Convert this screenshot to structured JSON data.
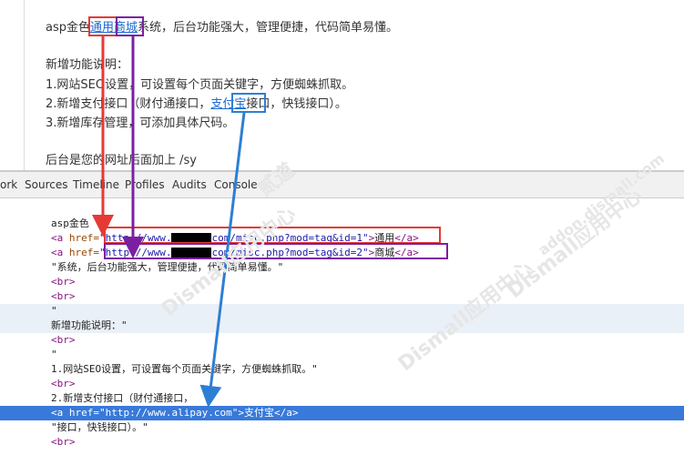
{
  "article": {
    "line1_pre": "asp金色",
    "line1_link1": "通用",
    "line1_link2": "商城",
    "line1_post": "系统，后台功能强大，管理便捷，代码简单易懂。",
    "features_title": "新增功能说明：",
    "feature1": "1.网站SEO设置，可设置每个页面关键字，方便蜘蛛抓取。",
    "feature2_pre": "2.新增支付接口（财付通接口，",
    "feature2_link": "支付宝",
    "feature2_post": "接口，快钱接口）。",
    "feature3": "3.新增库存管理，可添加具体尺码。",
    "footer": "后台是您的网址后面加上 /sy"
  },
  "devtools_tabs": [
    "ork",
    "Sources",
    "Timeline",
    "Profiles",
    "Audits",
    "Console"
  ],
  "dom": {
    "text_asp": "asp金色",
    "a1_open": "<a ",
    "a1_href_attr": "href=",
    "a1_href_pre": "\"http://www.",
    "a1_href_post": "com/misc.php?mod=tag&id=1\"",
    "a1_text": "通用",
    "a2_href_post": "com/misc.php?mod=tag&id=2\"",
    "a2_text": "商城",
    "text_system": "\"系统，后台功能强大，管理便捷，代码简单易懂。\"",
    "br": "<br>",
    "quote": "\"",
    "text_features": "新增功能说明：\"",
    "text_f1": "1.网站SEO设置，可设置每个页面关键字，方便蜘蛛抓取。\"",
    "text_f2": "2.新增支付接口（财付通接口，",
    "a3_href": "\"http://www.alipay.com\"",
    "a3_text": "支付宝",
    "text_f2_post": "\"接口，快钱接口）。\"",
    "close_a": "</a>",
    "gt": ">"
  },
  "watermarks": [
    "Dismall应用中心",
    "addon.dismall.com",
    "贰道"
  ]
}
